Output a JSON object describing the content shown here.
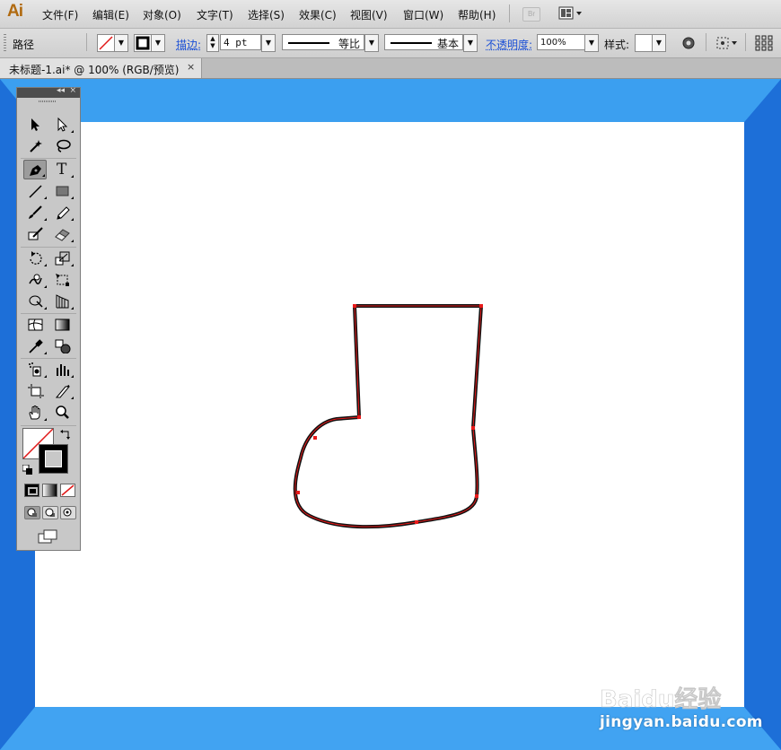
{
  "app": {
    "logo": "Ai"
  },
  "menu": [
    "文件(F)",
    "编辑(E)",
    "对象(O)",
    "文字(T)",
    "选择(S)",
    "效果(C)",
    "视图(V)",
    "窗口(W)",
    "帮助(H)"
  ],
  "menu_extra": {
    "bridge": "Br"
  },
  "control": {
    "object_type": "路径",
    "stroke_label": "描边:",
    "stroke_weight": "4 pt",
    "profile_label": "等比",
    "brush_label": "基本",
    "opacity_label": "不透明度:",
    "opacity_value": "100%",
    "style_label": "样式:"
  },
  "document": {
    "tab_title": "未标题-1.ai* @ 100% (RGB/预览)",
    "close": "×"
  },
  "toolbox": {
    "collapse": "◂◂",
    "close": "×",
    "tools": [
      "selection-tool",
      "direct-selection-tool",
      "magic-wand-tool",
      "lasso-tool",
      "pen-tool",
      "type-tool",
      "line-segment-tool",
      "rectangle-tool",
      "paintbrush-tool",
      "pencil-tool",
      "blob-brush-tool",
      "eraser-tool",
      "rotate-tool",
      "scale-tool",
      "warp-tool",
      "free-transform-tool",
      "shape-builder-tool",
      "perspective-grid-tool",
      "mesh-tool",
      "gradient-tool",
      "eyedropper-tool",
      "blend-tool",
      "symbol-sprayer-tool",
      "column-graph-tool",
      "artboard-tool",
      "slice-tool",
      "hand-tool",
      "zoom-tool"
    ],
    "active_tool": "pen-tool",
    "type_tool_glyph": "T"
  },
  "colors": {
    "canvas_bg": "#3da0f0",
    "canvas_bevel": "#1d6fd8",
    "stroke": "#000000",
    "path_points": "#e81b1b"
  },
  "watermark": {
    "brand": "Baidu经验",
    "url": "jingyan.baidu.com"
  }
}
